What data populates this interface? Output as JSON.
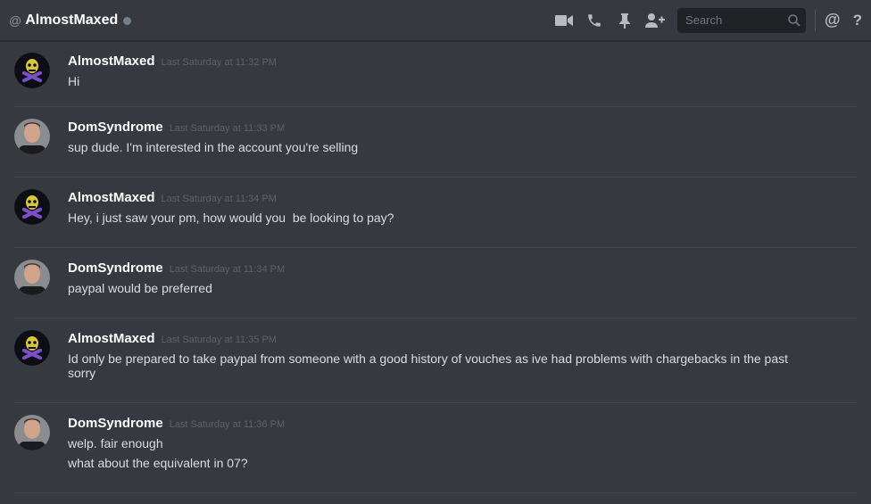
{
  "header": {
    "at_symbol": "@",
    "title": "AlmostMaxed",
    "status_color": "#747f8d",
    "icons": [
      "video-icon",
      "phone-icon",
      "pin-icon",
      "add-friend-icon"
    ],
    "search_placeholder": "Search",
    "mention_label": "@",
    "help_label": "?"
  },
  "messages": [
    {
      "author": "AlmostMaxed",
      "timestamp": "Last Saturday at 11:32 PM",
      "lines": [
        "Hi"
      ]
    },
    {
      "author": "DomSyndrome",
      "timestamp": "Last Saturday at 11:33 PM",
      "lines": [
        "sup dude. I'm interested in the account you're selling"
      ]
    },
    {
      "author": "AlmostMaxed",
      "timestamp": "Last Saturday at 11:34 PM",
      "lines": [
        "Hey, i just saw your pm, how would you  be looking to pay?"
      ]
    },
    {
      "author": "DomSyndrome",
      "timestamp": "Last Saturday at 11:34 PM",
      "lines": [
        "paypal would be preferred"
      ]
    },
    {
      "author": "AlmostMaxed",
      "timestamp": "Last Saturday at 11:35 PM",
      "lines": [
        "Id only be prepared to take paypal from someone with a good history of vouches as ive had problems with chargebacks in the past sorry"
      ]
    },
    {
      "author": "DomSyndrome",
      "timestamp": "Last Saturday at 11:36 PM",
      "lines": [
        "welp. fair enough",
        "what about the equivalent in 07?"
      ]
    }
  ]
}
